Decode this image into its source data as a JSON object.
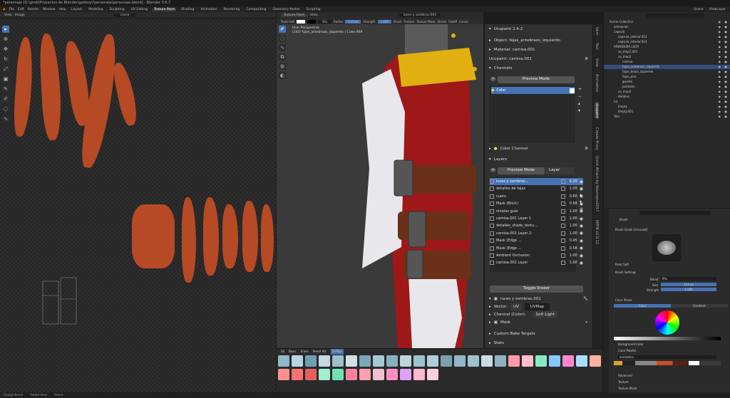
{
  "window": {
    "title": "*personaje [D:\\gnsb\\Proyectos de Blender\\gatboy\\*personaje\\personaje.blend] - Blender 3.6.7"
  },
  "menu": {
    "items": [
      "File",
      "Edit",
      "Render",
      "Window",
      "Help"
    ],
    "workspaces": [
      "Layout",
      "Modeling",
      "Sculpting",
      "UV Editing",
      "Texture Paint",
      "Shading",
      "Animation",
      "Rendering",
      "Compositing",
      "Geometry Nodes",
      "Scripting"
    ],
    "active_workspace": "Texture Paint",
    "scene": "Scene",
    "view_layer": "ViewLayer"
  },
  "uv_editor": {
    "view": "View",
    "image": "Image",
    "image_name": "cuero"
  },
  "viewport": {
    "mode": "Texture Paint",
    "view": "View",
    "overlay_line1": "User Perspective",
    "overlay_line2": "(143) fajas_antebrazo_izquierdo | Cube.009",
    "brush_name": "Paint Soft",
    "blend": "Mix",
    "radius_label": "Radius",
    "radius_value": "123 px",
    "strength_label": "Strength",
    "strength_value": "1.000",
    "brush": "Brush",
    "texture": "Texture",
    "texture_mask": "Texture Mask",
    "stroke": "Stroke",
    "falloff": "Falloff",
    "cursor": "Cursor",
    "file_label": "luces y sombras.001"
  },
  "ucupaint": {
    "title": "Ucupaint 2.4.2",
    "object": "Object: fajas_antebrazo_izquierdo",
    "material": "Material: camisa.001",
    "ucupaint_name": "Ucupaint: camisa.001",
    "channels_header": "Channels",
    "preview_mode": "Preview Mode",
    "channel_color": "Color",
    "color_channel": "Color Channel",
    "layers_header": "Layers",
    "layers_preview": "Preview Mode",
    "layers_dropdown": "Layer",
    "layers": [
      {
        "name": "luces y sombras...",
        "opacity": "0.20",
        "selected": true
      },
      {
        "name": "detalles de fajas",
        "opacity": "1.00",
        "selected": false
      },
      {
        "name": "cuero",
        "opacity": "0.60",
        "selected": false
      },
      {
        "name": "Mask (Brick)",
        "opacity": "0.58",
        "selected": false
      },
      {
        "name": "ninelas guia",
        "opacity": "1.00",
        "selected": false
      },
      {
        "name": "camisa.001 Layer 1",
        "opacity": "1.00",
        "selected": false
      },
      {
        "name": "detalles_shade_textu...",
        "opacity": "1.00",
        "selected": false
      },
      {
        "name": "camisa.001 Layer 2",
        "opacity": "1.00",
        "selected": false
      },
      {
        "name": "Mask (Edge ...",
        "opacity": "0.45",
        "selected": false
      },
      {
        "name": "Mask (Edge ...",
        "opacity": "0.58",
        "selected": false
      },
      {
        "name": "Ambient Occlusion",
        "opacity": "1.00",
        "selected": false
      },
      {
        "name": "camisa.001 Layer",
        "opacity": "1.00",
        "selected": false
      }
    ],
    "toggle_eraser": "Toggle Eraser",
    "active_layer": "luces y sombras.001",
    "vector_label": "Vector:",
    "vector_value": "UV",
    "uvmap": "UVMap",
    "channel_label": "Channel (Color):",
    "channel_value": "Soft Light",
    "mask": "Mask",
    "custom_bake": "Custom Bake Targets",
    "stats": "Stats"
  },
  "side_tabs": [
    "Item",
    "Tool",
    "View",
    "Animation",
    "Ucupaint",
    "Create Proxy",
    "Quick Attach by Neumann2017",
    "MPFB v2.0.12"
  ],
  "outliner": {
    "search_placeholder": "",
    "rows": [
      {
        "name": "Scene Collection",
        "indent": 0,
        "sel": false
      },
      {
        "name": "animacion",
        "indent": 1,
        "sel": false
      },
      {
        "name": "capsula",
        "indent": 1,
        "sel": false
      },
      {
        "name": "capsula_interior.013",
        "indent": 2,
        "sel": false
      },
      {
        "name": "capsula_interior.014",
        "indent": 2,
        "sel": false
      },
      {
        "name": "ARMADURA LISTA",
        "indent": 1,
        "sel": false
      },
      {
        "name": "uv_map2.001",
        "indent": 2,
        "sel": false
      },
      {
        "name": "uv_map2",
        "indent": 2,
        "sel": false
      },
      {
        "name": "camisa",
        "indent": 3,
        "sel": false
      },
      {
        "name": "fajas_antebrazo_izquierdo",
        "indent": 3,
        "sel": true
      },
      {
        "name": "fajas_brazo_izquierdo",
        "indent": 3,
        "sel": false
      },
      {
        "name": "fajas_pies",
        "indent": 3,
        "sel": false
      },
      {
        "name": "guante",
        "indent": 3,
        "sel": false
      },
      {
        "name": "pantalon",
        "indent": 3,
        "sel": false
      },
      {
        "name": "uv_map2",
        "indent": 2,
        "sel": false
      },
      {
        "name": "detalles",
        "indent": 2,
        "sel": false
      },
      {
        "name": "luz",
        "indent": 1,
        "sel": false
      },
      {
        "name": "Empty",
        "indent": 2,
        "sel": false
      },
      {
        "name": "Empty.001",
        "indent": 2,
        "sel": false
      },
      {
        "name": "Tele",
        "indent": 1,
        "sel": false
      }
    ]
  },
  "properties": {
    "brush": "Brush",
    "brush_asset": "Brush Asset (Unsaved)",
    "brush_name": "Paint Soft",
    "brush_settings": "Brush Settings",
    "blend_label": "Blend",
    "blend_value": "Mix",
    "size_label": "Size",
    "size_value": "123 px",
    "strength_label": "Strength",
    "strength_value": "1.000",
    "color_picker": "Color Picker",
    "color_tab": "Color",
    "gradient_tab": "Gradient",
    "background_color": "Background Color",
    "color_palette": "Color Palette",
    "palette_name": "animalera",
    "advanced": "Advanced",
    "texture": "Texture",
    "texture_mask": "Texture Mask"
  },
  "asset_shelf": {
    "tabs": [
      "All",
      "Basic",
      "Erase",
      "Pencil Art",
      "UVMap"
    ],
    "active_tab": "UVMap"
  },
  "status": {
    "items": [
      "Change Brush",
      "Rotate View",
      "Select"
    ]
  }
}
